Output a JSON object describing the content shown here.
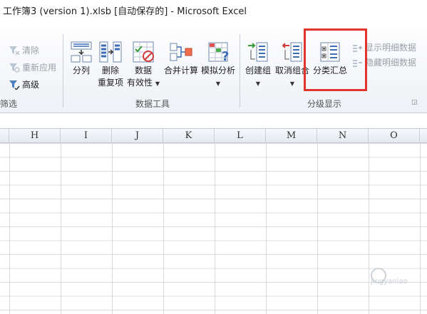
{
  "title": "工作簿3 (version 1).xlsb [自动保存的]  -  Microsoft Excel",
  "filter_group": {
    "clear_label": "清除",
    "reapply_label": "重新应用",
    "advanced_label": "高级",
    "group_label": "筛选"
  },
  "data_tools": {
    "text_to_columns": "分列",
    "remove_dup_line1": "删除",
    "remove_dup_line2": "重复项",
    "validation_line1": "数据",
    "validation_line2": "有效性",
    "consolidate": "合并计算",
    "what_if": "模拟分析",
    "group_label": "数据工具"
  },
  "outline": {
    "group_btn": "创建组",
    "ungroup_btn": "取消组合",
    "subtotal_btn": "分类汇总",
    "show_detail": "显示明细数据",
    "hide_detail": "隐藏明细数据",
    "group_label": "分级显示"
  },
  "columns": [
    "H",
    "I",
    "J",
    "K",
    "L",
    "M",
    "N",
    "O"
  ],
  "watermark": "jingyanlao"
}
